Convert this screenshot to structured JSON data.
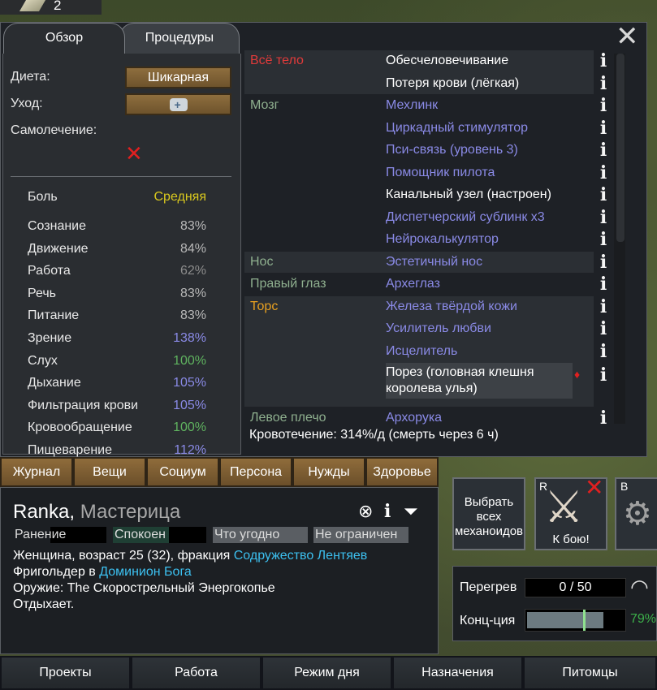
{
  "top_strip": {
    "count": "2"
  },
  "health": {
    "tabs": [
      "Обзор",
      "Процедуры"
    ],
    "diet_label": "Диета:",
    "diet_value": "Шикарная",
    "care_label": "Уход:",
    "self_tend_label": "Самолечение:",
    "pain": {
      "name": "Боль",
      "value": "Средняя",
      "color": "#d9c81e"
    },
    "capacities": [
      {
        "name": "Сознание",
        "value": "83%",
        "color": "#b8b8b8"
      },
      {
        "name": "Движение",
        "value": "84%",
        "color": "#b8b8b8"
      },
      {
        "name": "Работа",
        "value": "62%",
        "color": "#8c8c8c"
      },
      {
        "name": "Речь",
        "value": "83%",
        "color": "#b8b8b8"
      },
      {
        "name": "Питание",
        "value": "83%",
        "color": "#b8b8b8"
      },
      {
        "name": "Зрение",
        "value": "138%",
        "color": "#8a8ae6"
      },
      {
        "name": "Слух",
        "value": "100%",
        "color": "#5fb35f"
      },
      {
        "name": "Дыхание",
        "value": "105%",
        "color": "#8a8ae6"
      },
      {
        "name": "Фильтрация крови",
        "value": "105%",
        "color": "#8a8ae6"
      },
      {
        "name": "Кровообращение",
        "value": "100%",
        "color": "#5fb35f"
      },
      {
        "name": "Пищеварение",
        "value": "112%",
        "color": "#8a8ae6"
      }
    ],
    "parts": [
      {
        "name": "Всё тело",
        "color": "#e03a3a",
        "hediffs": [
          {
            "label": "Обесчеловечивание",
            "color": "#ffffff"
          },
          {
            "label": "Потеря крови (лёгкая)",
            "color": "#ffffff"
          }
        ]
      },
      {
        "name": "Мозг",
        "color": "#8fb08f",
        "hediffs": [
          {
            "label": "Мехлинк",
            "color": "#8a8ae6"
          },
          {
            "label": "Циркадный стимулятор",
            "color": "#8a8ae6"
          },
          {
            "label": "Пси-связь (уровень 3)",
            "color": "#8a8ae6"
          },
          {
            "label": "Помощник пилота",
            "color": "#8a8ae6"
          },
          {
            "label": "Канальный узел (настроен)",
            "color": "#ffffff"
          },
          {
            "label": "Диспетчерский сублинк x3",
            "color": "#8a8ae6"
          },
          {
            "label": "Нейрокалькулятор",
            "color": "#8a8ae6"
          }
        ]
      },
      {
        "name": "Нос",
        "color": "#8fb08f",
        "hediffs": [
          {
            "label": "Эстетичный нос",
            "color": "#8a8ae6"
          }
        ]
      },
      {
        "name": "Правый глаз",
        "color": "#8fb08f",
        "hediffs": [
          {
            "label": "Археглаз",
            "color": "#8a8ae6"
          }
        ]
      },
      {
        "name": "Торс",
        "color": "#e8a020",
        "hediffs": [
          {
            "label": "Железа твёрдой кожи",
            "color": "#8a8ae6"
          },
          {
            "label": "Усилитель любви",
            "color": "#8a8ae6"
          },
          {
            "label": "Исцелитель",
            "color": "#8a8ae6"
          },
          {
            "label": "Порез (головная клешня королева улья)",
            "color": "#ffffff",
            "bleeding": true
          }
        ]
      },
      {
        "name": "Левое плечо",
        "color": "#8fb08f",
        "hediffs": [
          {
            "label": "Архорука",
            "color": "#8a8ae6"
          }
        ]
      }
    ],
    "bleeding_text": "Кровотечение: 314%/д (смерть через 6 ч)"
  },
  "inspect_tabs": [
    "Журнал",
    "Вещи",
    "Социум",
    "Персона",
    "Нужды",
    "Здоровье"
  ],
  "pawn": {
    "name": "Ranka",
    "title": "Мастерица",
    "stats": [
      "Ранение",
      "Спокоен",
      "Что угодно",
      "Не ограничен"
    ],
    "line1_prefix": "Женщина, возраст 25 (32), фракция ",
    "line1_faction": "Содружество Лентяев",
    "line2_prefix": "Фригольдер в ",
    "line2_link": "Доминион Бога",
    "weapon": "Оружие: The Скорострельный Энергокопье",
    "status": "Отдыхает."
  },
  "gizmos": {
    "select_label": "Выбрать всех механоидов",
    "fight_hotkey": "R",
    "fight_label": "К бою!",
    "third_hotkey": "B"
  },
  "mech": {
    "heat_label": "Перегрев",
    "heat_value": "0 / 50",
    "conc_label": "Конц-ция",
    "conc_pct": "79%",
    "conc_fraction": 0.79,
    "conc_target": 0.58
  },
  "bottom_tabs": [
    "Проекты",
    "Работа",
    "Режим дня",
    "Назначения",
    "Питомцы"
  ]
}
